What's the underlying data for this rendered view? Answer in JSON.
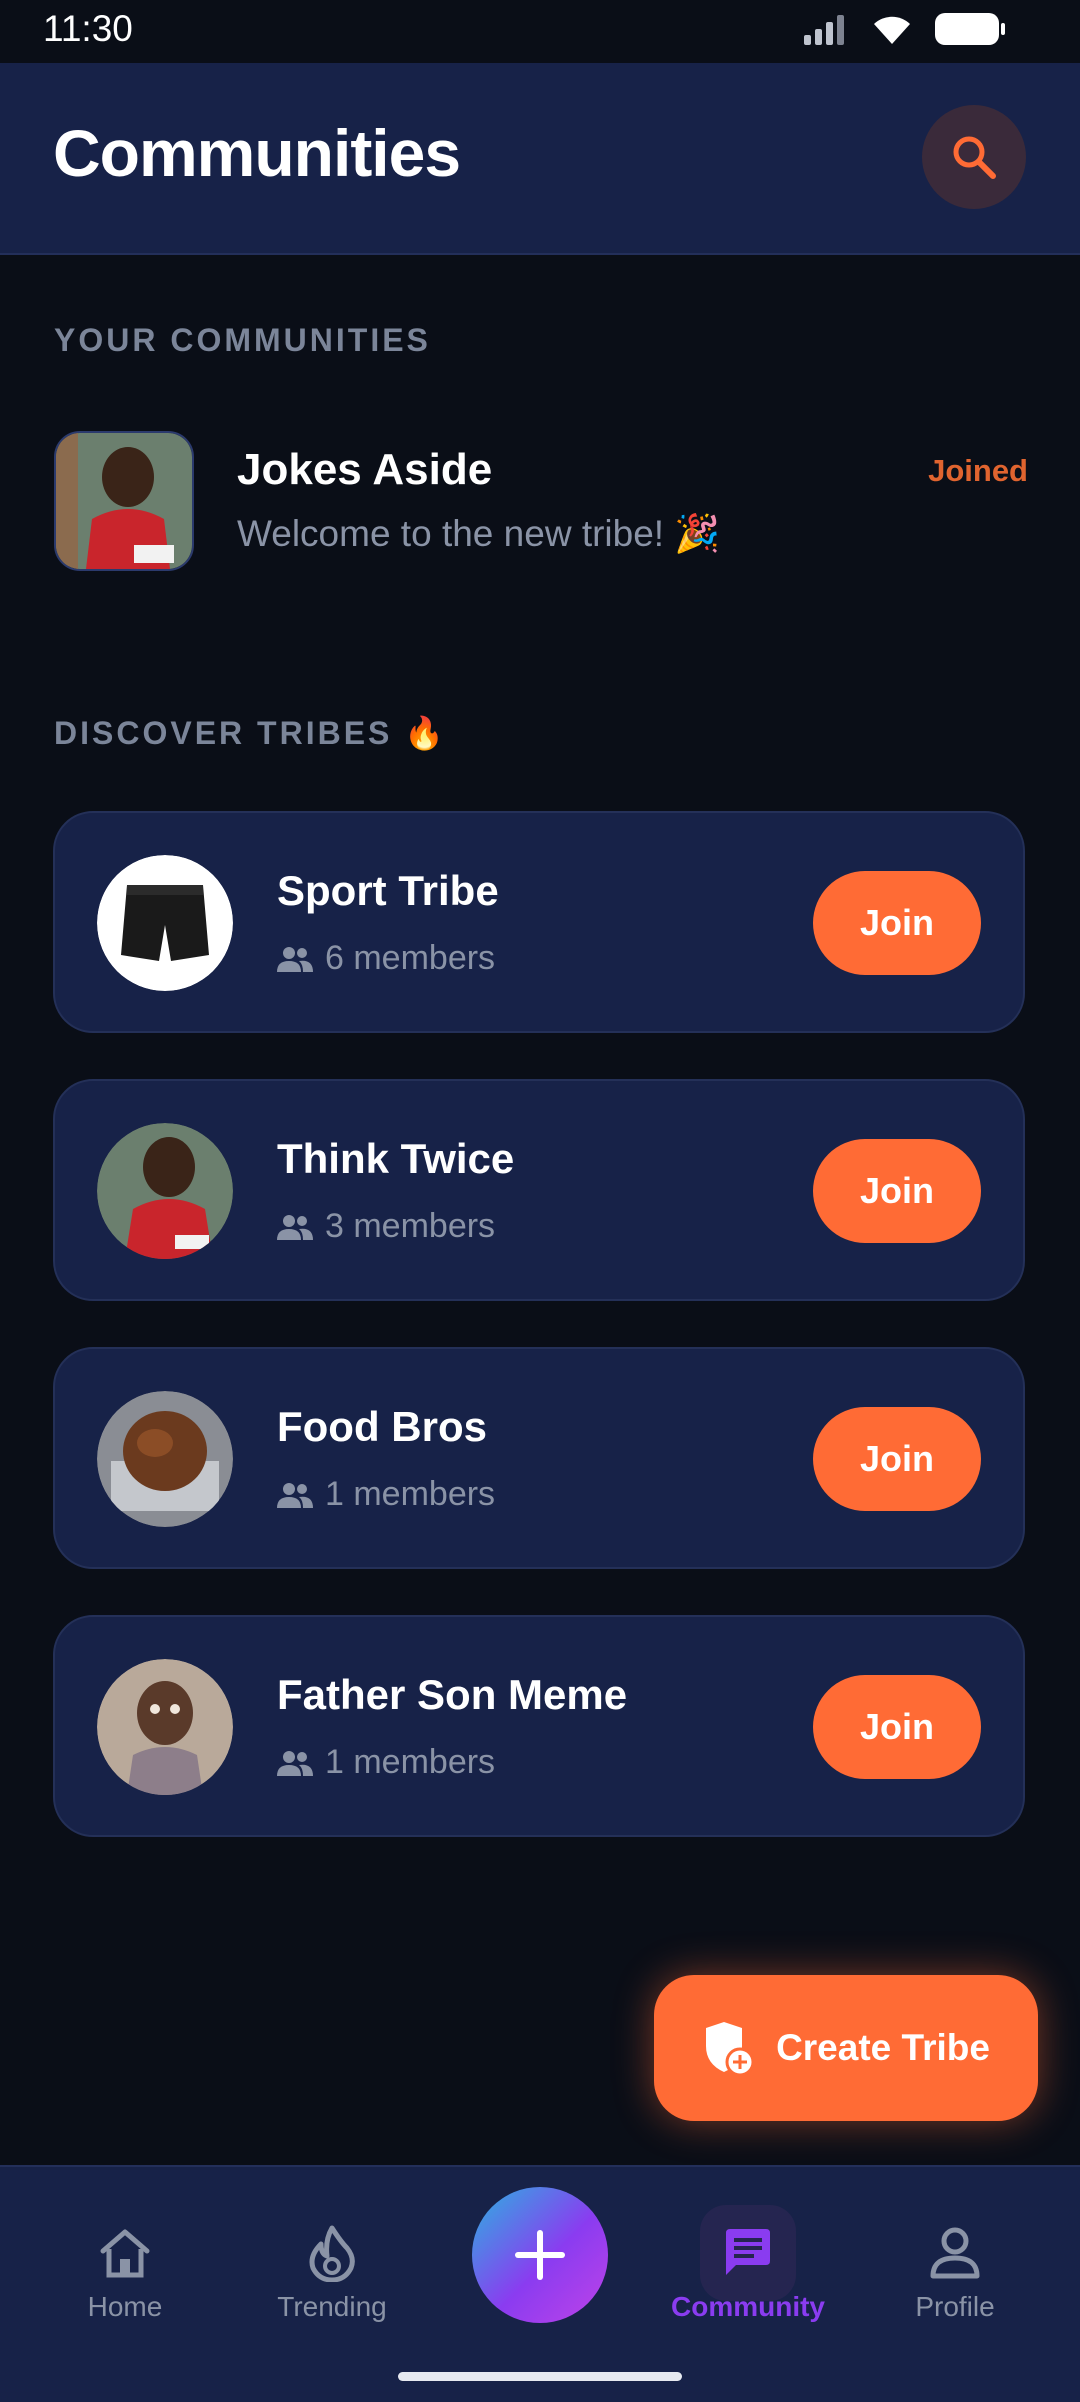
{
  "status_bar": {
    "time": "11:30"
  },
  "header": {
    "title": "Communities"
  },
  "your_communities": {
    "heading": "YOUR COMMUNITIES",
    "items": [
      {
        "name": "Jokes Aside",
        "subtitle": "Welcome to the new tribe! 🎉",
        "status": "Joined"
      }
    ]
  },
  "discover": {
    "heading": "DISCOVER TRIBES 🔥",
    "tribes": [
      {
        "name": "Sport Tribe",
        "members": "6 members",
        "join_label": "Join",
        "avatar": "shorts-photo"
      },
      {
        "name": "Think Twice",
        "members": "3 members",
        "join_label": "Join",
        "avatar": "person-photo"
      },
      {
        "name": "Food Bros",
        "members": "1 members",
        "join_label": "Join",
        "avatar": "food-photo"
      },
      {
        "name": "Father Son Meme",
        "members": "1 members",
        "join_label": "Join",
        "avatar": "child-photo"
      }
    ]
  },
  "fab": {
    "label": "Create Tribe"
  },
  "bottom_nav": {
    "items": [
      {
        "label": "Home",
        "icon": "home-icon"
      },
      {
        "label": "Trending",
        "icon": "flame-icon"
      },
      {
        "label": "",
        "icon": "plus-icon"
      },
      {
        "label": "Community",
        "icon": "chat-icon",
        "active": true
      },
      {
        "label": "Profile",
        "icon": "person-icon"
      }
    ]
  },
  "colors": {
    "accent": "#ff6b35",
    "active_nav": "#8a3cf0",
    "card_bg": "#172248",
    "page_bg": "#0a0e17"
  }
}
